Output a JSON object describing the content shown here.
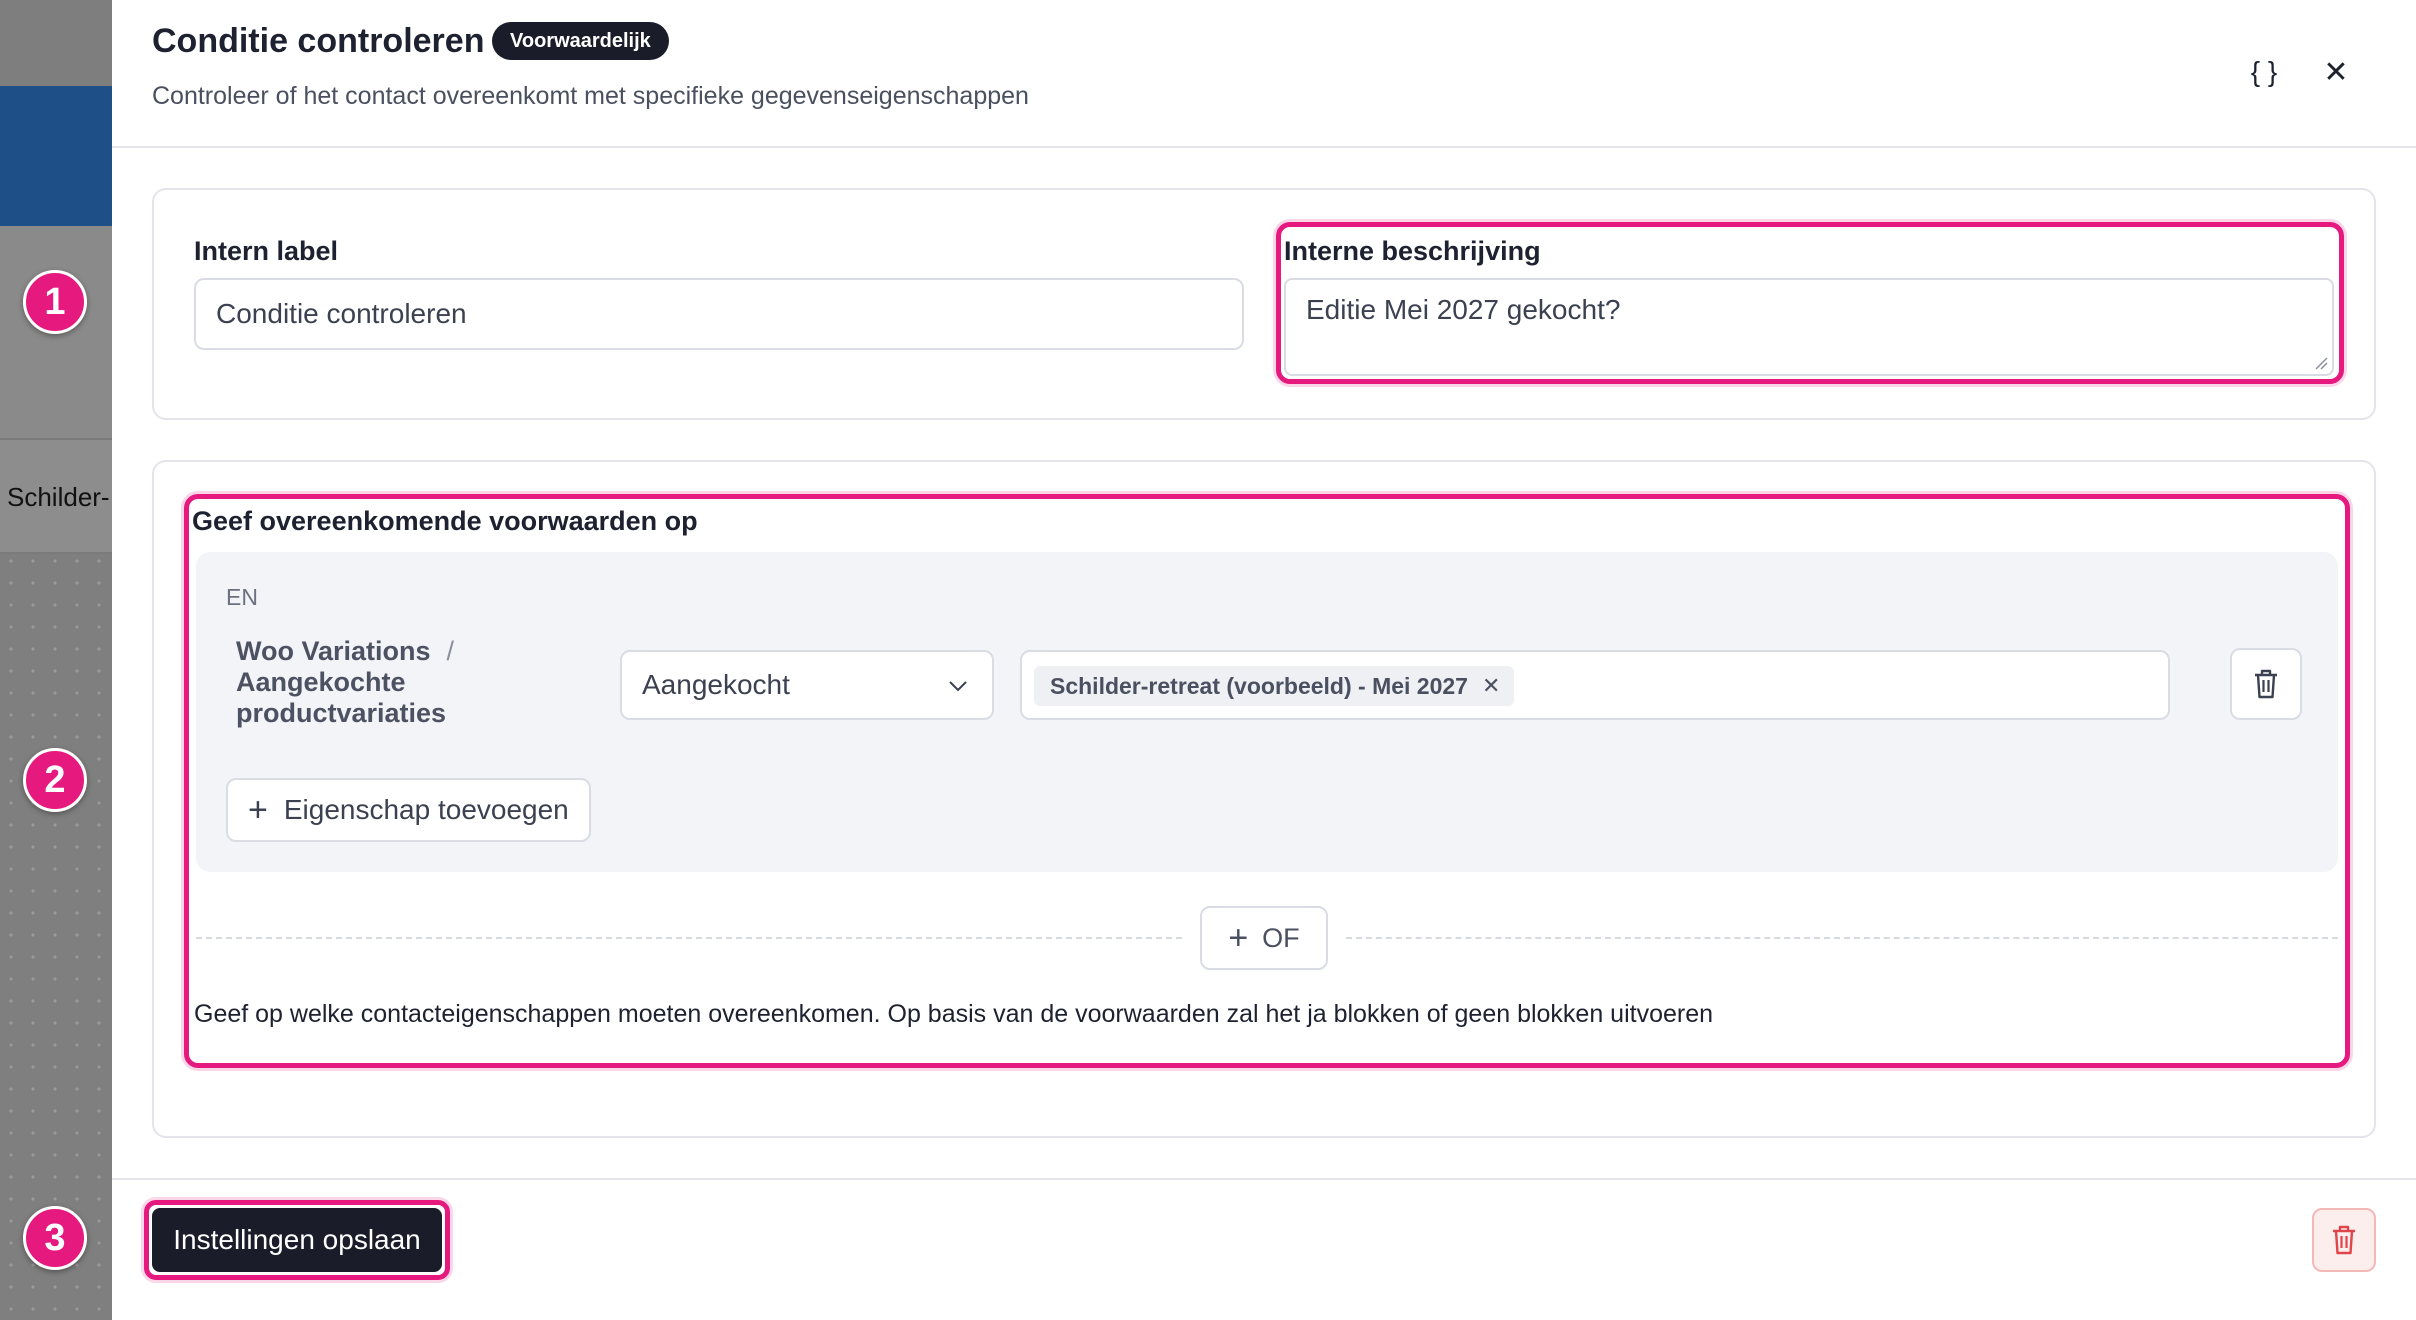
{
  "background": {
    "visible_label": "Schilder-"
  },
  "steps": [
    "1",
    "2",
    "3"
  ],
  "modal": {
    "title": "Conditie controleren",
    "badge": "Voorwaardelijk",
    "subtitle": "Controleer of het contact overeenkomt met specifieke gegevenseigenschappen",
    "icons": {
      "code": "{ }",
      "close": "✕"
    }
  },
  "fields": {
    "internal_label": {
      "label": "Intern label",
      "value": "Conditie controleren"
    },
    "internal_description": {
      "label": "Interne beschrijving",
      "value": "Editie Mei 2027 gekocht?"
    }
  },
  "conditions": {
    "title": "Geef overeenkomende voorwaarden op",
    "group_operator": "EN",
    "rule": {
      "property_source": "Woo Variations",
      "separator": "/",
      "property_name": "Aangekochte productvariaties",
      "operator": "Aangekocht",
      "values": [
        "Schilder-retreat (voorbeeld) - Mei 2027"
      ]
    },
    "add_property_label": "Eigenschap toevoegen",
    "or_label": "OF",
    "helper_text": "Geef op welke contacteigenschappen moeten overeenkomen. Op basis van de voorwaarden zal het ja blokken of geen blokken uitvoeren"
  },
  "footer": {
    "save_label": "Instellingen opslaan"
  },
  "colors": {
    "highlight": "#e5197e",
    "primary_dark": "#1a1d29",
    "danger": "#e0444b"
  }
}
